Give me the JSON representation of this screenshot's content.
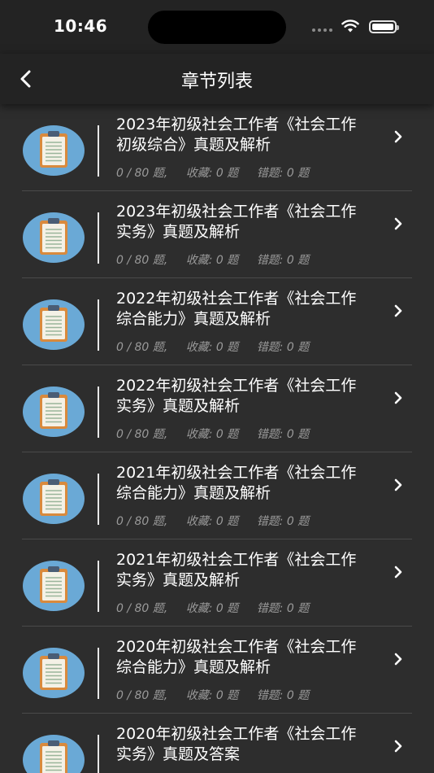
{
  "status": {
    "time": "10:46"
  },
  "nav": {
    "title": "章节列表"
  },
  "items": [
    {
      "title": "2023年初级社会工作者《社会工作初级综合》真题及解析",
      "progress": "0 / 80 题,",
      "favorites": "收藏: 0 题",
      "errors": "错题: 0 题"
    },
    {
      "title": "2023年初级社会工作者《社会工作实务》真题及解析",
      "progress": "0 / 80 题,",
      "favorites": "收藏: 0 题",
      "errors": "错题: 0 题"
    },
    {
      "title": "2022年初级社会工作者《社会工作综合能力》真题及解析",
      "progress": "0 / 80 题,",
      "favorites": "收藏: 0 题",
      "errors": "错题: 0 题"
    },
    {
      "title": "2022年初级社会工作者《社会工作实务》真题及解析",
      "progress": "0 / 80 题,",
      "favorites": "收藏: 0 题",
      "errors": "错题: 0 题"
    },
    {
      "title": "2021年初级社会工作者《社会工作综合能力》真题及解析",
      "progress": "0 / 80 题,",
      "favorites": "收藏: 0 题",
      "errors": "错题: 0 题"
    },
    {
      "title": "2021年初级社会工作者《社会工作实务》真题及解析",
      "progress": "0 / 80 题,",
      "favorites": "收藏: 0 题",
      "errors": "错题: 0 题"
    },
    {
      "title": "2020年初级社会工作者《社会工作综合能力》真题及解析",
      "progress": "0 / 80 题,",
      "favorites": "收藏: 0 题",
      "errors": "错题: 0 题"
    },
    {
      "title": "2020年初级社会工作者《社会工作实务》真题及答案",
      "progress": "",
      "favorites": "",
      "errors": ""
    }
  ]
}
